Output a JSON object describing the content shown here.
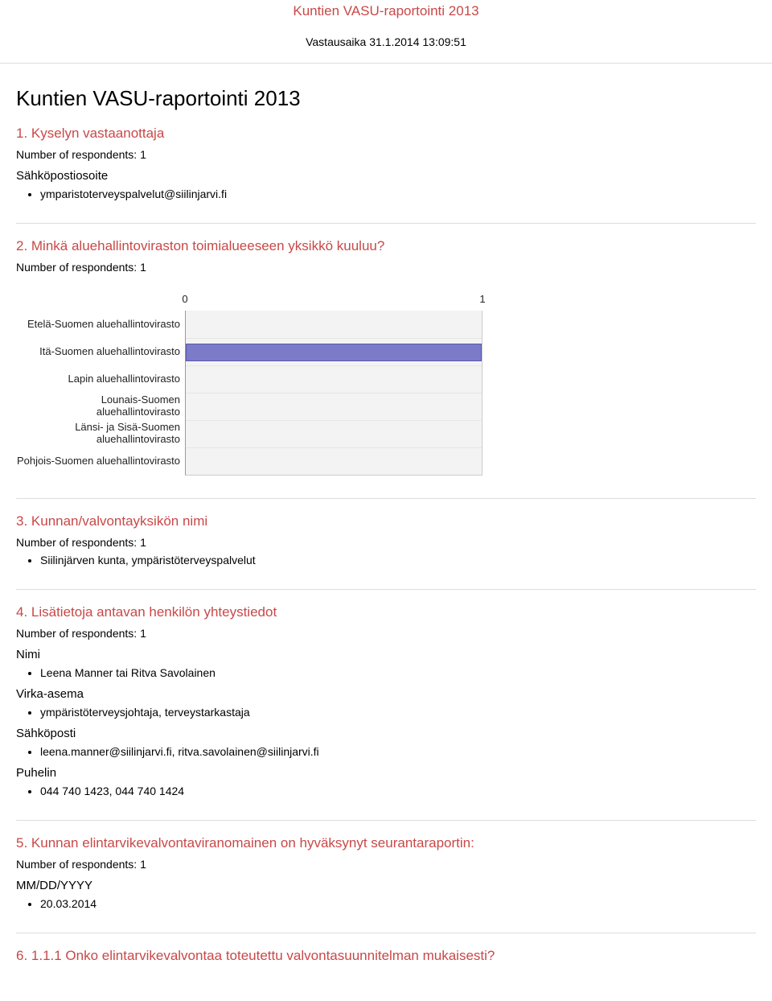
{
  "header": {
    "title": "Kuntien VASU-raportointi 2013",
    "subtitle": "Vastausaika 31.1.2014 13:09:51"
  },
  "main_title": "Kuntien VASU-raportointi 2013",
  "q1": {
    "title": "1. Kyselyn vastaanottaja",
    "respondents": "Number of respondents: 1",
    "field_label": "Sähköpostiosoite",
    "answer": "ymparistoterveyspalvelut@siilinjarvi.fi"
  },
  "q2": {
    "title": "2. Minkä aluehallintoviraston toimialueeseen yksikkö kuuluu?",
    "respondents": "Number of respondents: 1"
  },
  "q3": {
    "title": "3. Kunnan/valvontayksikön nimi",
    "respondents": "Number of respondents: 1",
    "answer": "Siilinjärven kunta, ympäristöterveyspalvelut"
  },
  "q4": {
    "title": "4. Lisätietoja antavan henkilön yhteystiedot",
    "respondents": "Number of respondents: 1",
    "nimi_label": "Nimi",
    "nimi": "Leena Manner tai Ritva Savolainen",
    "virka_label": "Virka-asema",
    "virka": "ympäristöterveysjohtaja, terveystarkastaja",
    "email_label": "Sähköposti",
    "email": "leena.manner@siilinjarvi.fi, ritva.savolainen@siilinjarvi.fi",
    "puhelin_label": "Puhelin",
    "puhelin": "044 740 1423, 044 740 1424"
  },
  "q5": {
    "title": "5. Kunnan elintarvikevalvontaviranomainen on hyväksynyt seurantaraportin:",
    "respondents": "Number of respondents: 1",
    "field_label": "MM/DD/YYYY",
    "answer": "20.03.2014"
  },
  "q6": {
    "title": "6. 1.1.1 Onko elintarvikevalvontaa toteutettu valvontasuunnitelman mukaisesti?"
  },
  "chart_data": {
    "type": "bar",
    "orientation": "horizontal",
    "categories": [
      "Etelä-Suomen aluehallintovirasto",
      "Itä-Suomen aluehallintovirasto",
      "Lapin aluehallintovirasto",
      "Lounais-Suomen aluehallintovirasto",
      "Länsi- ja Sisä-Suomen aluehallintovirasto",
      "Pohjois-Suomen aluehallintovirasto"
    ],
    "values": [
      0,
      1,
      0,
      0,
      0,
      0
    ],
    "xlim": [
      0,
      1
    ],
    "xticks": [
      0,
      1
    ],
    "title": "",
    "xlabel": "",
    "ylabel": ""
  }
}
